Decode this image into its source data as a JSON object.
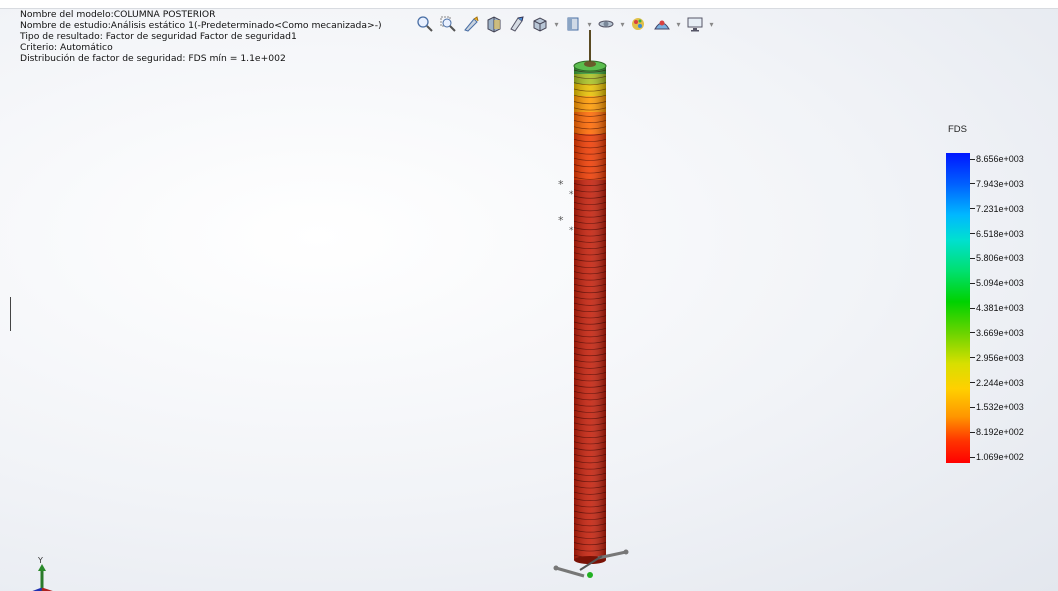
{
  "info": {
    "model_name": "Nombre del modelo:COLUMNA POSTERIOR",
    "study_name": "Nombre de estudio:Análisis estático 1(-Predeterminado<Como mecanizada>-)",
    "result_type": "Tipo de resultado: Factor de seguridad Factor de seguridad1",
    "criterion": "Criterio: Automático",
    "distribution": "Distribución de factor de seguridad: FDS mín = 1.1e+002"
  },
  "toolbar": {
    "icons": [
      "zoom-to-fit-icon",
      "zoom-to-area-icon",
      "previous-view-icon",
      "section-view-icon",
      "view-orientation-icon",
      "display-style-icon",
      "hide-show-items-icon",
      "edit-appearance-icon",
      "apply-scene-icon",
      "view-settings-icon"
    ]
  },
  "legend": {
    "title": "FDS",
    "ticks": [
      "8.656e+003",
      "7.943e+003",
      "7.231e+003",
      "6.518e+003",
      "5.806e+003",
      "5.094e+003",
      "4.381e+003",
      "3.669e+003",
      "2.956e+003",
      "2.244e+003",
      "1.532e+003",
      "8.192e+002",
      "1.069e+002"
    ],
    "colors": {
      "max": "#0017ff",
      "min": "#ff0000"
    }
  },
  "triad": {
    "y_label": "Y"
  }
}
